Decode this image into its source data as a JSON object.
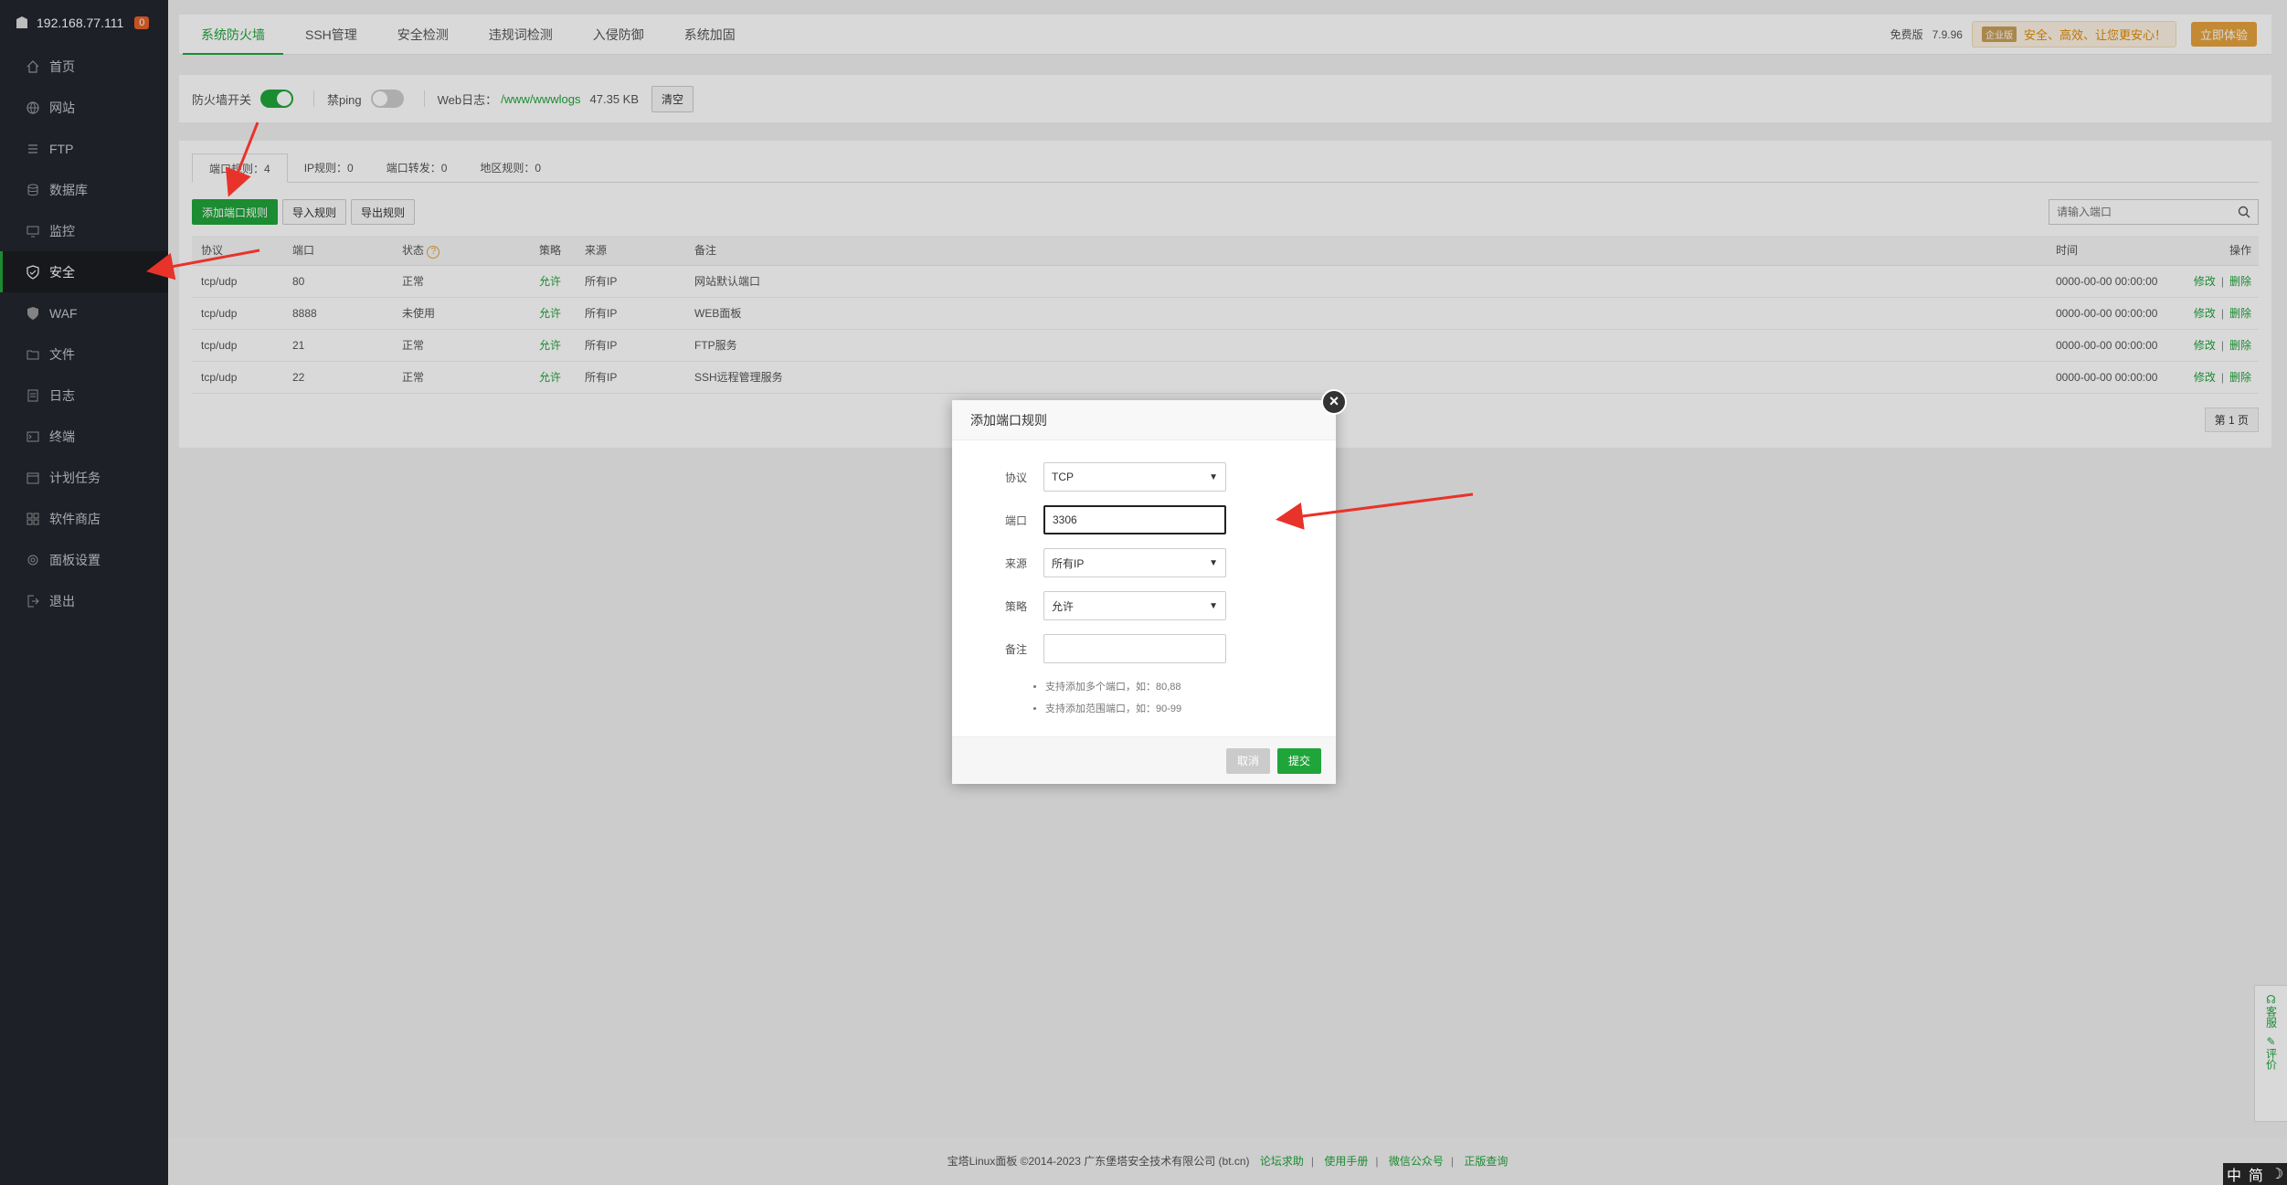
{
  "sidebar": {
    "ip": "192.168.77.111",
    "badge": "0",
    "items": [
      {
        "label": "首页",
        "icon": "home-icon"
      },
      {
        "label": "网站",
        "icon": "globe-icon"
      },
      {
        "label": "FTP",
        "icon": "ftp-icon"
      },
      {
        "label": "数据库",
        "icon": "database-icon"
      },
      {
        "label": "监控",
        "icon": "monitor-icon"
      },
      {
        "label": "安全",
        "icon": "shield-icon"
      },
      {
        "label": "WAF",
        "icon": "waf-icon"
      },
      {
        "label": "文件",
        "icon": "folder-icon"
      },
      {
        "label": "日志",
        "icon": "log-icon"
      },
      {
        "label": "终端",
        "icon": "terminal-icon"
      },
      {
        "label": "计划任务",
        "icon": "calendar-icon"
      },
      {
        "label": "软件商店",
        "icon": "apps-icon"
      },
      {
        "label": "面板设置",
        "icon": "settings-icon"
      },
      {
        "label": "退出",
        "icon": "logout-icon"
      }
    ]
  },
  "topbar": {
    "tabs": [
      "系统防火墙",
      "SSH管理",
      "安全检测",
      "违规词检测",
      "入侵防御",
      "系统加固"
    ],
    "edition": "免费版",
    "version": "7.9.96",
    "promo_badge": "企业版",
    "promo": "安全、高效、让您更安心！",
    "try_label": "立即体验"
  },
  "toolrow": {
    "firewall_label": "防火墙开关",
    "ping_label": "禁ping",
    "weblog_label": "Web日志：",
    "weblog_path": "/www/wwwlogs",
    "weblog_size": "47.35 KB",
    "clear_label": "清空"
  },
  "subtabs": [
    "端口规则：4",
    "IP规则：0",
    "端口转发：0",
    "地区规则：0"
  ],
  "actions": {
    "add": "添加端口规则",
    "import": "导入规则",
    "export": "导出规则",
    "search_placeholder": "请输入端口"
  },
  "table": {
    "headers": [
      "协议",
      "端口",
      "状态",
      "策略",
      "来源",
      "备注",
      "时间",
      "操作"
    ],
    "rows": [
      {
        "protocol": "tcp/udp",
        "port": "80",
        "status": "正常",
        "policy": "允许",
        "source": "所有IP",
        "note": "网站默认端口",
        "time": "0000-00-00 00:00:00"
      },
      {
        "protocol": "tcp/udp",
        "port": "8888",
        "status": "未使用",
        "policy": "允许",
        "source": "所有IP",
        "note": "WEB面板",
        "time": "0000-00-00 00:00:00"
      },
      {
        "protocol": "tcp/udp",
        "port": "21",
        "status": "正常",
        "policy": "允许",
        "source": "所有IP",
        "note": "FTP服务",
        "time": "0000-00-00 00:00:00"
      },
      {
        "protocol": "tcp/udp",
        "port": "22",
        "status": "正常",
        "policy": "允许",
        "source": "所有IP",
        "note": "SSH远程管理服务",
        "time": "0000-00-00 00:00:00"
      }
    ],
    "edit": "修改",
    "delete": "删除",
    "pager": "第 1 页"
  },
  "modal": {
    "title": "添加端口规则",
    "protocol_label": "协议",
    "protocol_value": "TCP",
    "port_label": "端口",
    "port_value": "3306",
    "source_label": "来源",
    "source_value": "所有IP",
    "policy_label": "策略",
    "policy_value": "允许",
    "note_label": "备注",
    "note_value": "",
    "tips": [
      "支持添加多个端口，如：80,88",
      "支持添加范围端口，如：90-99"
    ],
    "cancel": "取消",
    "submit": "提交"
  },
  "footer": {
    "copyright": "宝塔Linux面板 ©2014-2023 广东堡塔安全技术有限公司 (bt.cn)",
    "links": [
      "论坛求助",
      "使用手册",
      "微信公众号",
      "正版查询"
    ]
  },
  "float": {
    "service": "客服",
    "review": "评价"
  },
  "ime": {
    "zh": "中",
    "simp": "简"
  },
  "colors": {
    "accent": "#20a53a",
    "sidebar": "#23262e",
    "arrow": "#e8332a"
  }
}
